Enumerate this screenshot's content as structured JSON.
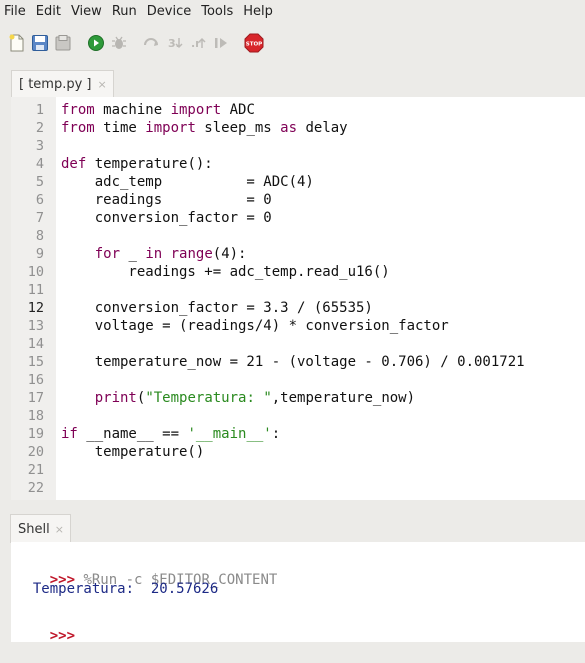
{
  "menubar": {
    "items": [
      "File",
      "Edit",
      "View",
      "Run",
      "Device",
      "Tools",
      "Help"
    ]
  },
  "toolbar": {
    "icons": [
      "new-file-icon",
      "save-icon",
      "open-icon",
      "run-icon",
      "debug-icon",
      "step-over-icon",
      "step-into-icon",
      "step-out-icon",
      "resume-icon",
      "stop-icon"
    ],
    "stop_label": "STOP"
  },
  "editor": {
    "tab_label": "[ temp.py ]",
    "tab_close": "×",
    "current_line": 12,
    "line_numbers": [
      "1",
      "2",
      "3",
      "4",
      "5",
      "6",
      "7",
      "8",
      "9",
      "10",
      "11",
      "12",
      "13",
      "14",
      "15",
      "16",
      "17",
      "18",
      "19",
      "20",
      "21",
      "22"
    ],
    "lines": [
      [
        {
          "t": "from",
          "c": "kw"
        },
        {
          "t": " machine "
        },
        {
          "t": "import",
          "c": "kw"
        },
        {
          "t": " ADC"
        }
      ],
      [
        {
          "t": "from",
          "c": "kw"
        },
        {
          "t": " time "
        },
        {
          "t": "import",
          "c": "kw"
        },
        {
          "t": " sleep_ms "
        },
        {
          "t": "as",
          "c": "kw"
        },
        {
          "t": " delay"
        }
      ],
      [],
      [
        {
          "t": "def",
          "c": "kw"
        },
        {
          "t": " temperature():"
        }
      ],
      [
        {
          "t": "    adc_temp          = ADC(4)"
        }
      ],
      [
        {
          "t": "    readings          = 0"
        }
      ],
      [
        {
          "t": "    conversion_factor = 0"
        }
      ],
      [],
      [
        {
          "t": "    "
        },
        {
          "t": "for",
          "c": "kw"
        },
        {
          "t": " _ "
        },
        {
          "t": "in",
          "c": "kw"
        },
        {
          "t": " "
        },
        {
          "t": "range",
          "c": "kw"
        },
        {
          "t": "(4):"
        }
      ],
      [
        {
          "t": "        readings += adc_temp.read_u16()"
        }
      ],
      [],
      [
        {
          "t": "    conversion_factor = 3.3 / (65535)"
        }
      ],
      [
        {
          "t": "    voltage = (readings/4) * conversion_factor"
        }
      ],
      [],
      [
        {
          "t": "    temperature_now = 21 - (voltage - 0.706) / 0.001721"
        }
      ],
      [],
      [
        {
          "t": "    "
        },
        {
          "t": "print",
          "c": "kw"
        },
        {
          "t": "("
        },
        {
          "t": "\"Temperatura: \"",
          "c": "str"
        },
        {
          "t": ",temperature_now)"
        }
      ],
      [],
      [
        {
          "t": "if",
          "c": "kw"
        },
        {
          "t": " __name__ == "
        },
        {
          "t": "'__main__'",
          "c": "str"
        },
        {
          "t": ":"
        }
      ],
      [
        {
          "t": "    temperature()"
        }
      ],
      [],
      []
    ]
  },
  "shell": {
    "tab_label": "Shell",
    "tab_close": "×",
    "prompt": ">>>",
    "command": " %Run -c $EDITOR_CONTENT",
    "output": "  Temperatura:  20.57626",
    "prompt2": ">>>"
  }
}
